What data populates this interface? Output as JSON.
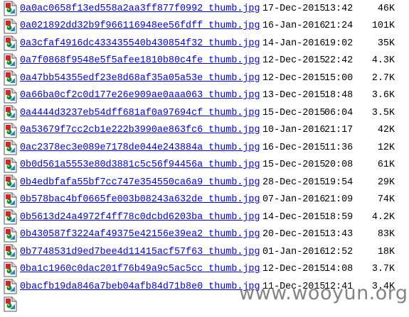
{
  "files": [
    {
      "name": "0a0ac0658f13ed558a2aa3ff877f0992_thumb.jpg",
      "date": "17-Dec-2015",
      "time": "13:42",
      "size": "46K"
    },
    {
      "name": "0a021892dd32b9f966116948ee56fdff_thumb.jpg",
      "date": "16-Jan-2016",
      "time": "21:24",
      "size": "101K"
    },
    {
      "name": "0a3cfaf4916dc433435540b430854f32_thumb.jpg",
      "date": "14-Jan-2016",
      "time": "19:02",
      "size": "35K"
    },
    {
      "name": "0a7f0868f9548e5f5afee1810b80c4fe_thumb.jpg",
      "date": "12-Dec-2015",
      "time": "22:42",
      "size": "4.3K"
    },
    {
      "name": "0a47bb54355edf23e8d68af35a05a53e_thumb.jpg",
      "date": "12-Dec-2015",
      "time": "15:00",
      "size": "2.7K"
    },
    {
      "name": "0a66ba0cf2c0d177e26e909ae0aaa063_thumb.jpg",
      "date": "13-Dec-2015",
      "time": "18:48",
      "size": "3.6K"
    },
    {
      "name": "0a4444d3237eb54dff681af0a97694cf_thumb.jpg",
      "date": "15-Dec-2015",
      "time": "06:04",
      "size": "3.5K"
    },
    {
      "name": "0a53679f7cc2cb1e222b3990ae863fc6_thumb.jpg",
      "date": "10-Jan-2016",
      "time": "21:17",
      "size": "42K"
    },
    {
      "name": "0ac2378ec3e089e7178de044e243884a_thumb.jpg",
      "date": "16-Dec-2015",
      "time": "11:36",
      "size": "12K"
    },
    {
      "name": "0b0d561a5553e80d3881c5c56f94456a_thumb.jpg",
      "date": "15-Dec-2015",
      "time": "20:08",
      "size": "61K"
    },
    {
      "name": "0b4edbfafa55bf7cc747e354550ca6a9_thumb.jpg",
      "date": "28-Dec-2015",
      "time": "19:54",
      "size": "29K"
    },
    {
      "name": "0b578bac4bf0665fe003b08243a632de_thumb.jpg",
      "date": "07-Jan-2016",
      "time": "21:09",
      "size": "74K"
    },
    {
      "name": "0b5613d24a4972f4ff78c0dcbd6203ba_thumb.jpg",
      "date": "14-Dec-2015",
      "time": "18:59",
      "size": "4.2K"
    },
    {
      "name": "0b430587f3224af49375e42156e39ea2_thumb.jpg",
      "date": "20-Dec-2015",
      "time": "13:43",
      "size": "83K"
    },
    {
      "name": "0b7748531d9ed7bee4d11415acf57f63_thumb.jpg",
      "date": "01-Jan-2016",
      "time": "12:52",
      "size": "18K"
    },
    {
      "name": "0ba1c1960c0dac201f76b49a9c5ac5cc_thumb.jpg",
      "date": "12-Dec-2015",
      "time": "14:08",
      "size": "3.7K"
    },
    {
      "name": "0bacfb19da846a7beb04afb84d71b8e0_thumb.jpg",
      "date": "11-Dec-2015",
      "time": "12:41",
      "size": "3.4K"
    }
  ],
  "watermark": "www.wooyun.org",
  "colors": {
    "link": "#0000ee",
    "icon_red": "#e02020",
    "icon_green": "#1a8a2a",
    "icon_blue": "#1e88c8"
  }
}
